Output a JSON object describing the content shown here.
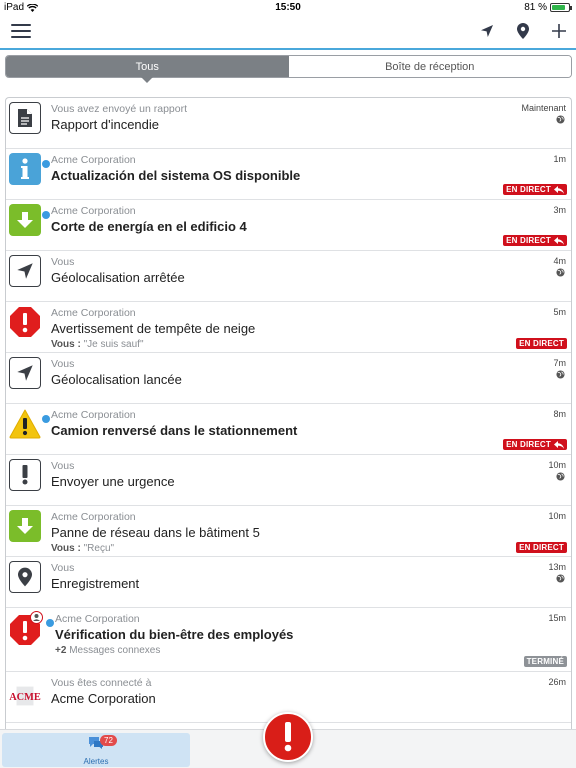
{
  "status": {
    "carrier": "iPad",
    "time": "15:50",
    "battery": "81 %",
    "battery_level": 0.81
  },
  "segments": {
    "all": "Tous",
    "inbox": "Boîte de réception"
  },
  "colors": {
    "accent": "#4aa8db",
    "unread_dot": "#3a9be0",
    "live_badge": "#d0101c",
    "alert_red": "#e01d1d",
    "green": "#7bbd2a",
    "yellow": "#f2c40f",
    "info_blue": "#4aa3d8"
  },
  "rows": [
    {
      "sender": "Vous avez envoyé un rapport",
      "title": "Rapport d'incendie",
      "time": "Maintenant",
      "icon": "document-icon"
    },
    {
      "sender": "Acme Corporation",
      "title": "Actualización del sistema OS disponible",
      "time": "1m",
      "badge": "EN DIRECT",
      "icon": "info-icon"
    },
    {
      "sender": "Acme Corporation",
      "title": "Corte de energía en el edificio 4",
      "time": "3m",
      "badge": "EN DIRECT",
      "icon": "arrow-down-icon"
    },
    {
      "sender": "Vous",
      "title": "Géolocalisation arrêtée",
      "time": "4m",
      "icon": "location-arrow-icon"
    },
    {
      "sender": "Acme Corporation",
      "title": "Avertissement de tempête de neige",
      "sub_label": "Vous :",
      "sub_text": "\"Je suis sauf\"",
      "time": "5m",
      "badge": "EN DIRECT",
      "icon": "stop-alert-icon"
    },
    {
      "sender": "Vous",
      "title": "Géolocalisation lancée",
      "time": "7m",
      "icon": "location-arrow-icon"
    },
    {
      "sender": "Acme Corporation",
      "title": "Camion renversé dans le stationnement",
      "time": "8m",
      "badge": "EN DIRECT",
      "icon": "warning-icon"
    },
    {
      "sender": "Vous",
      "title": "Envoyer une urgence",
      "time": "10m",
      "icon": "exclamation-icon"
    },
    {
      "sender": "Acme Corporation",
      "title": "Panne de réseau dans le bâtiment 5",
      "sub_label": "Vous :",
      "sub_text": "\"Reçu\"",
      "time": "10m",
      "badge": "EN DIRECT",
      "icon": "arrow-down-icon"
    },
    {
      "sender": "Vous",
      "title": "Enregistrement",
      "time": "13m",
      "icon": "map-pin-icon"
    },
    {
      "sender": "Acme Corporation",
      "title": "Vérification du bien-être des employés",
      "sub_label": "+2",
      "sub_text": "Messages connexes",
      "time": "15m",
      "badge": "TERMINÉ",
      "icon": "stop-alert-icon"
    },
    {
      "sender": "Vous êtes connecté à",
      "title": "Acme Corporation",
      "time": "26m",
      "icon": "acme-logo",
      "logo_text": "ACME"
    }
  ],
  "tabbar": {
    "alerts_label": "Alertes",
    "alerts_count": "72"
  }
}
